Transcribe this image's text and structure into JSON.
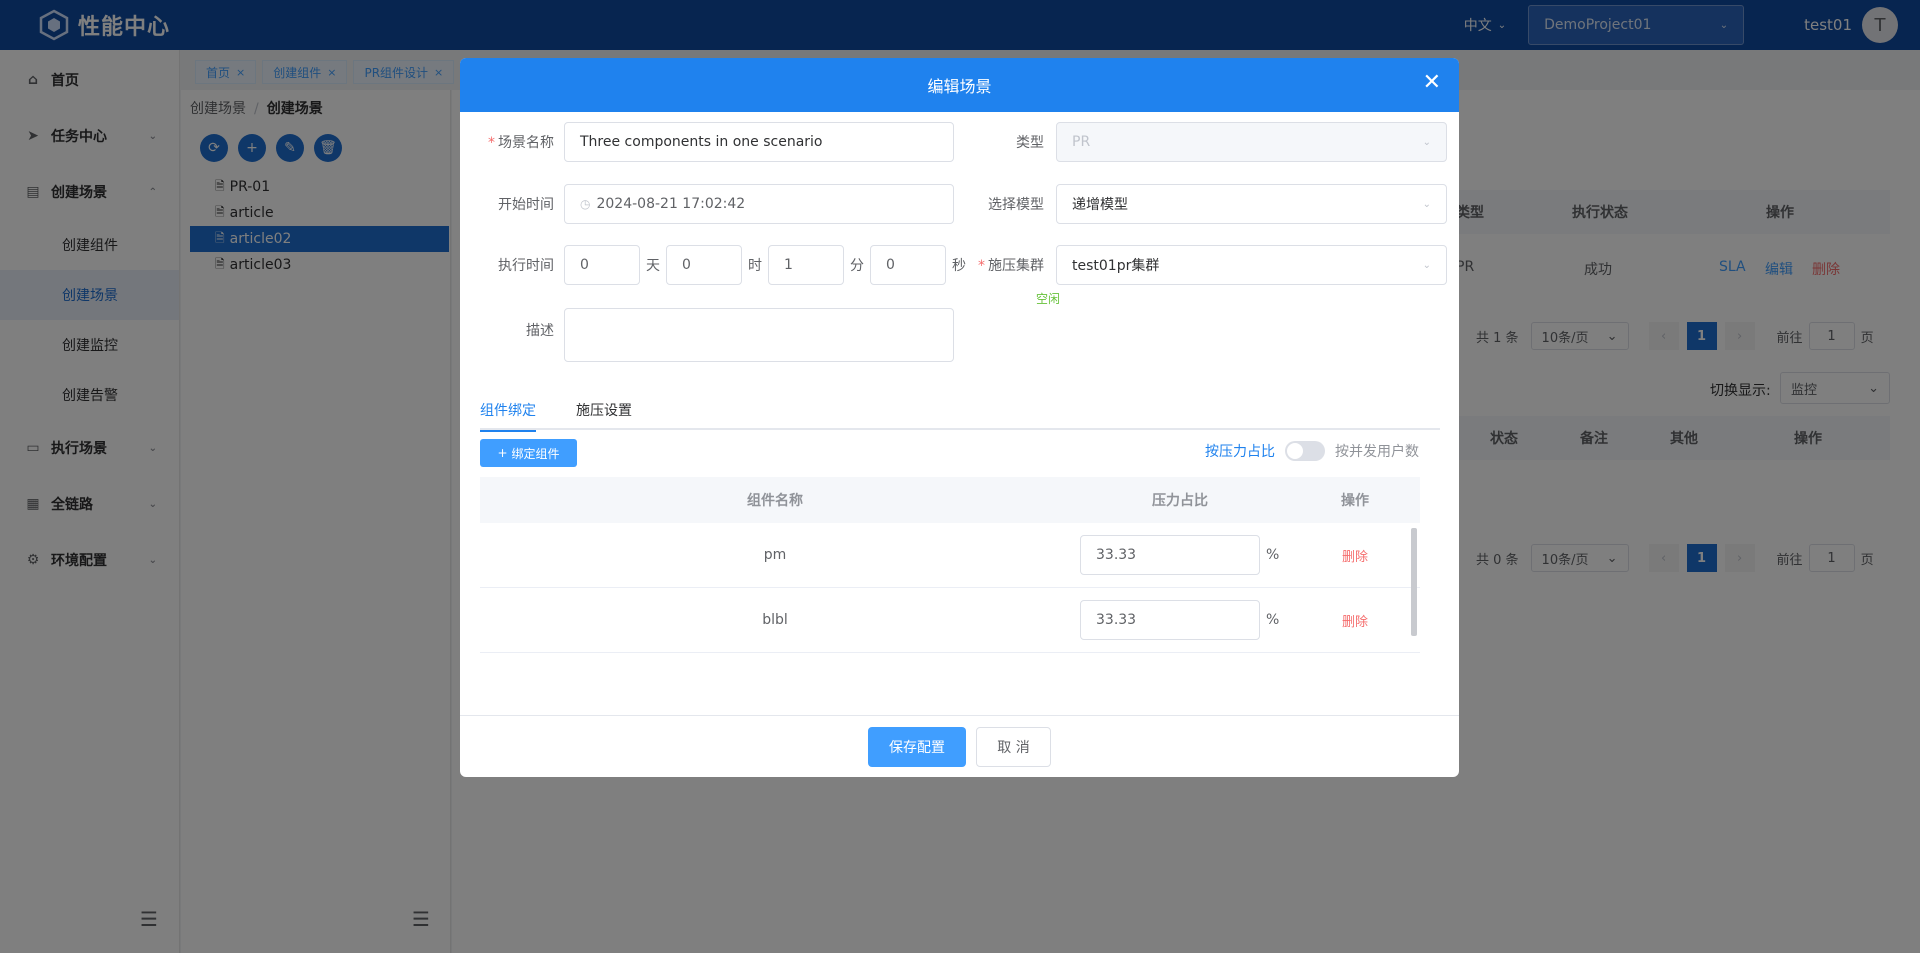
{
  "app": {
    "title": "性能中心"
  },
  "header": {
    "lang": "中文",
    "project": "DemoProject01",
    "user": "test01",
    "avatar_letter": "T"
  },
  "sidebar": {
    "items": [
      {
        "label": "首页"
      },
      {
        "label": "任务中心"
      },
      {
        "label": "创建场景"
      },
      {
        "label": "执行场景"
      },
      {
        "label": "全链路"
      },
      {
        "label": "环境配置"
      }
    ],
    "sub": [
      {
        "label": "创建组件"
      },
      {
        "label": "创建场景"
      },
      {
        "label": "创建监控"
      },
      {
        "label": "创建告警"
      }
    ]
  },
  "tags": [
    {
      "label": "首页"
    },
    {
      "label": "创建组件"
    },
    {
      "label": "PR组件设计"
    }
  ],
  "breadcrumb": {
    "parent": "创建场景",
    "current": "创建场景"
  },
  "tree": {
    "nodes": [
      {
        "label": "PR-01"
      },
      {
        "label": "article"
      },
      {
        "label": "article02"
      },
      {
        "label": "article03"
      }
    ]
  },
  "background": {
    "table_headers": [
      "类型",
      "执行状态",
      "操作"
    ],
    "row": {
      "type": "PR",
      "status": "成功",
      "sla": "SLA",
      "edit": "编辑",
      "delete": "删除"
    },
    "pager1": {
      "total": "共 1 条",
      "size": "10条/页",
      "page": "1",
      "goto": "前往",
      "goto_val": "1",
      "suffix": "页"
    },
    "switch_label": "切换显示:",
    "switch_value": "监控",
    "table2_headers": [
      "状态",
      "备注",
      "其他",
      "操作"
    ],
    "pager2": {
      "total": "共 0 条",
      "size": "10条/页",
      "page": "1",
      "goto": "前往",
      "goto_val": "1",
      "suffix": "页"
    }
  },
  "modal": {
    "title": "编辑场景",
    "fields": {
      "name_label": "场景名称",
      "name_value": "Three components in one scenario",
      "type_label": "类型",
      "type_value": "PR",
      "start_label": "开始时间",
      "start_value": "2024-08-21 17:02:42",
      "model_label": "选择模型",
      "model_value": "递增模型",
      "exec_label": "执行时间",
      "days": "0",
      "days_unit": "天",
      "hours": "0",
      "hours_unit": "时",
      "minutes": "1",
      "minutes_unit": "分",
      "seconds": "0",
      "seconds_unit": "秒",
      "cluster_label": "施压集群",
      "cluster_value": "test01pr集群",
      "cluster_status": "空闲",
      "desc_label": "描述",
      "desc_value": ""
    },
    "tabs": [
      {
        "label": "组件绑定"
      },
      {
        "label": "施压设置"
      }
    ],
    "bind_button": "绑定组件",
    "toggle_on": "按压力占比",
    "toggle_off": "按并发用户数",
    "table": {
      "headers": [
        "组件名称",
        "压力占比",
        "操作"
      ],
      "rows": [
        {
          "name": "pm",
          "ratio": "33.33",
          "unit": "%",
          "op": "删除"
        },
        {
          "name": "blbl",
          "ratio": "33.33",
          "unit": "%",
          "op": "删除"
        }
      ]
    },
    "save": "保存配置",
    "cancel": "取 消"
  }
}
